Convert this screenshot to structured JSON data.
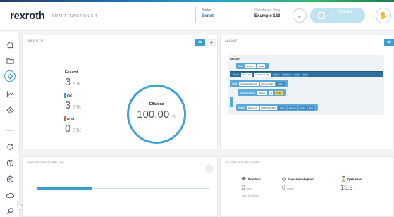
{
  "header": {
    "logo": "rexroth",
    "product": "SMART FUNCTION KIT",
    "status_label": "Status",
    "status_value": "Bereit",
    "program_label": "Geladenes Prog.",
    "program_value": "Example 123",
    "start_label": "START",
    "accent": "#3a9fd0",
    "control_bg": "#bfe3f1"
  },
  "sidebar": {
    "items": [
      {
        "icon": "home-icon"
      },
      {
        "icon": "folder-icon"
      },
      {
        "icon": "process-icon",
        "active": true
      },
      {
        "icon": "chart-icon"
      },
      {
        "icon": "tag-icon"
      },
      {
        "icon": "refresh-icon"
      },
      {
        "icon": "help-icon"
      },
      {
        "icon": "settings-icon"
      },
      {
        "icon": "cloud-icon"
      },
      {
        "icon": "search-icon"
      }
    ]
  },
  "overview": {
    "title": "ÜBERSICHT",
    "total_label": "Gesamt",
    "total_value": "3",
    "total_unit": "STK",
    "ok_label": "OK",
    "ok_value": "3",
    "ok_unit": "STK",
    "nok_label": "NOK",
    "nok_value": "0",
    "nok_unit": "STK",
    "efficiency_label": "Effizienz",
    "efficiency_value": "100,00",
    "efficiency_unit": "%"
  },
  "sequence": {
    "title": "ABLAUF",
    "start_label": "ABLAUF",
    "rows": [
      {
        "label": "Start",
        "chips": [
          "Modul 1",
          "Ende"
        ]
      },
      {
        "label": "Setze",
        "chips": [
          "Hand Ein",
          "UMSCHALTEN",
          "Wert",
          "Position",
          "Kraft",
          "Zeit"
        ]
      },
      {
        "label": "Falls",
        "chips": [
          "Signal erfasst von",
          "Sensor_links",
          "Dann"
        ]
      },
      {
        "label": "Signalzustand",
        "chips": [
          "Warten",
          "im",
          "0,000"
        ]
      },
      {
        "label": "Setze",
        "chips": [
          "Hand Aus",
          "UMSCHALTEN",
          "Wert",
          "Position",
          "Kraft",
          "Zeit"
        ]
      }
    ]
  },
  "production": {
    "title": "PRODUKTIONSVERLAUF",
    "progress": 0.32
  },
  "current_process": {
    "title": "AKTUELLER PROZESS",
    "position_label": "Position",
    "position_value": "0",
    "position_unit": "mm",
    "position_sub": "max. 30,00 mm",
    "speed_label": "Geschwindigkeit",
    "speed_value": "0",
    "speed_unit": "mm/s",
    "cycle_label": "Zykluszeit",
    "cycle_value": "15,9",
    "cycle_unit": "s"
  }
}
